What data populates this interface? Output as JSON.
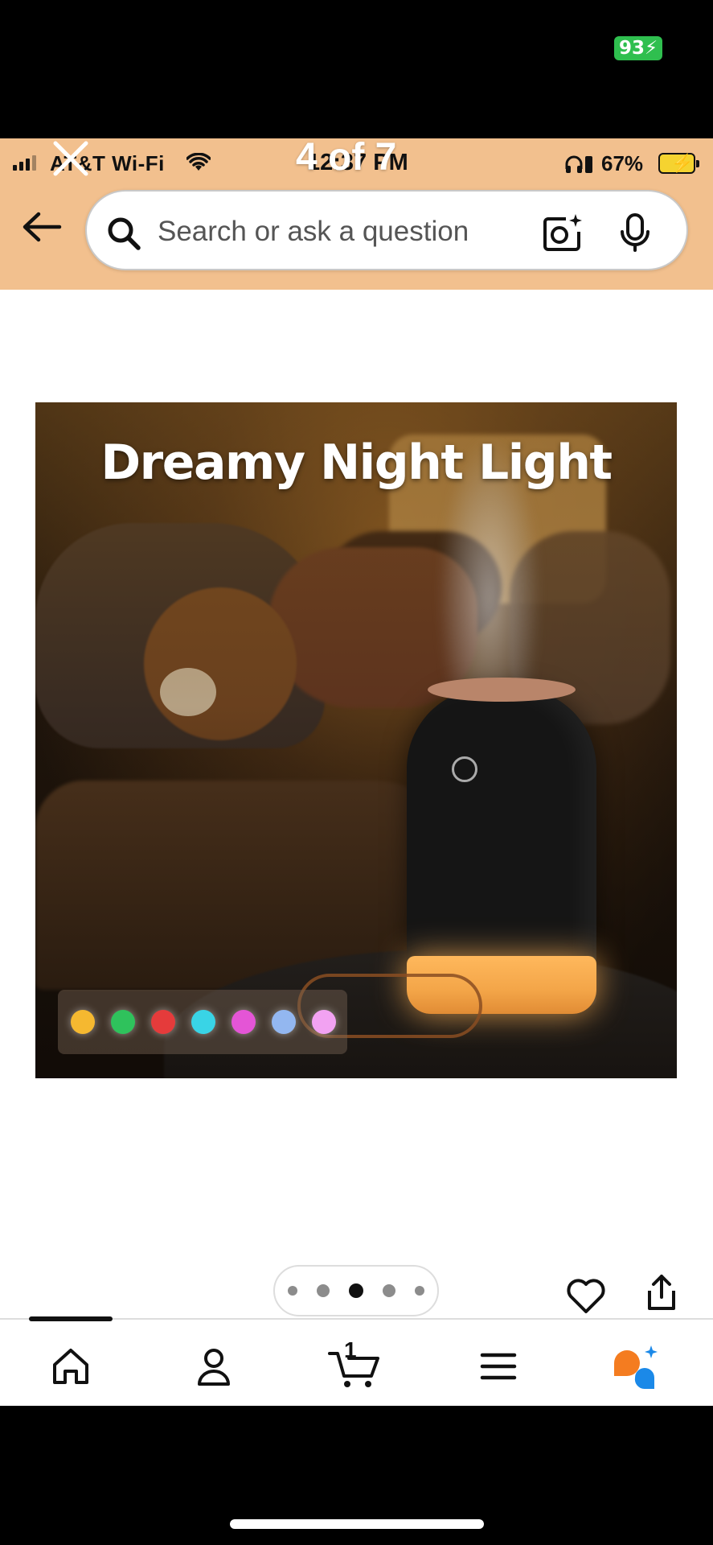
{
  "outer_status": {
    "battery": "93"
  },
  "status_bar": {
    "carrier": "AT&T Wi-Fi",
    "time": "12:37 PM",
    "battery_percent": "67%"
  },
  "viewer": {
    "counter": "4 of 7"
  },
  "search": {
    "placeholder": "Search or ask a question"
  },
  "product_image": {
    "headline": "Dreamy Night Light",
    "light_colors": [
      "#f5b830",
      "#2fc25c",
      "#e53b3b",
      "#39d4e6",
      "#e455d6",
      "#93b7f0",
      "#f2a2f2"
    ]
  },
  "pager": {
    "total": 5,
    "active_index": 2
  },
  "tab_bar": {
    "items": [
      "home-icon",
      "account-icon",
      "cart-icon",
      "menu-icon",
      "rufus-assistant-icon"
    ],
    "cart_count": "1"
  },
  "colors": {
    "header_bg": "#f2c08e",
    "outer_battery": "#2fbf4f",
    "assistant_orange": "#f47c20",
    "assistant_blue": "#1b89e8"
  }
}
